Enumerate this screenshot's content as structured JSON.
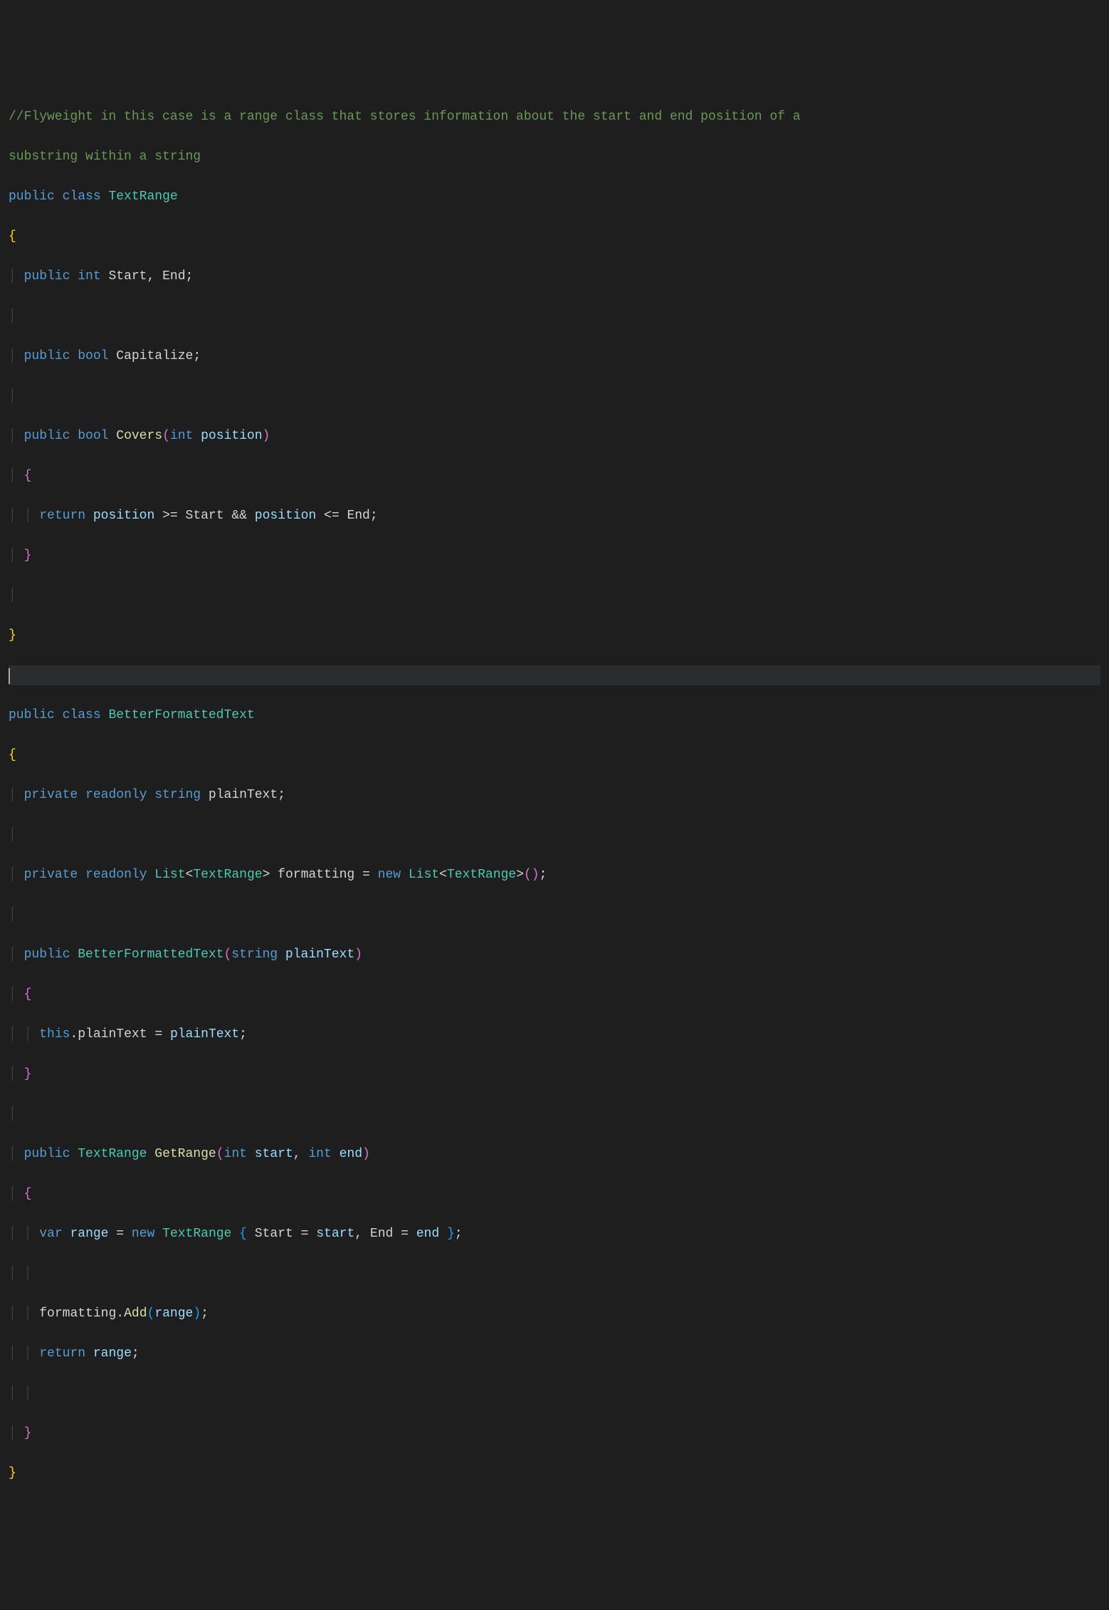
{
  "code": {
    "comment_l1": "//Flyweight in this case is a range class that stores information about the start and end position of a",
    "comment_l2": "substring within a string",
    "kw_public": "public",
    "kw_class": "class",
    "kw_private": "private",
    "kw_readonly": "readonly",
    "kw_int": "int",
    "kw_bool": "bool",
    "kw_string": "string",
    "kw_return": "return",
    "kw_this": "this",
    "kw_var": "var",
    "kw_new": "new",
    "type_TextRange": "TextRange",
    "type_BetterFormattedText": "BetterFormattedText",
    "type_List": "List",
    "fld_Start": "Start",
    "fld_End": "End",
    "fld_Capitalize": "Capitalize",
    "fld_plainText": "plainText",
    "fld_formatting": "formatting",
    "mth_Covers": "Covers",
    "mth_GetRange": "GetRange",
    "mth_Add": "Add",
    "prm_position": "position",
    "prm_plainText": "plainText",
    "prm_start": "start",
    "prm_end": "end",
    "loc_range": "range",
    "op_gte": ">=",
    "op_lte": "<=",
    "op_and": "&&",
    "op_assign": "=",
    "sym_comma": ",",
    "sym_semi": ";",
    "sym_dot": ".",
    "sym_lbrace": "{",
    "sym_rbrace": "}",
    "sym_lparen": "(",
    "sym_rparen": ")",
    "sym_lt": "<",
    "sym_gt": ">",
    "guide": "│"
  }
}
